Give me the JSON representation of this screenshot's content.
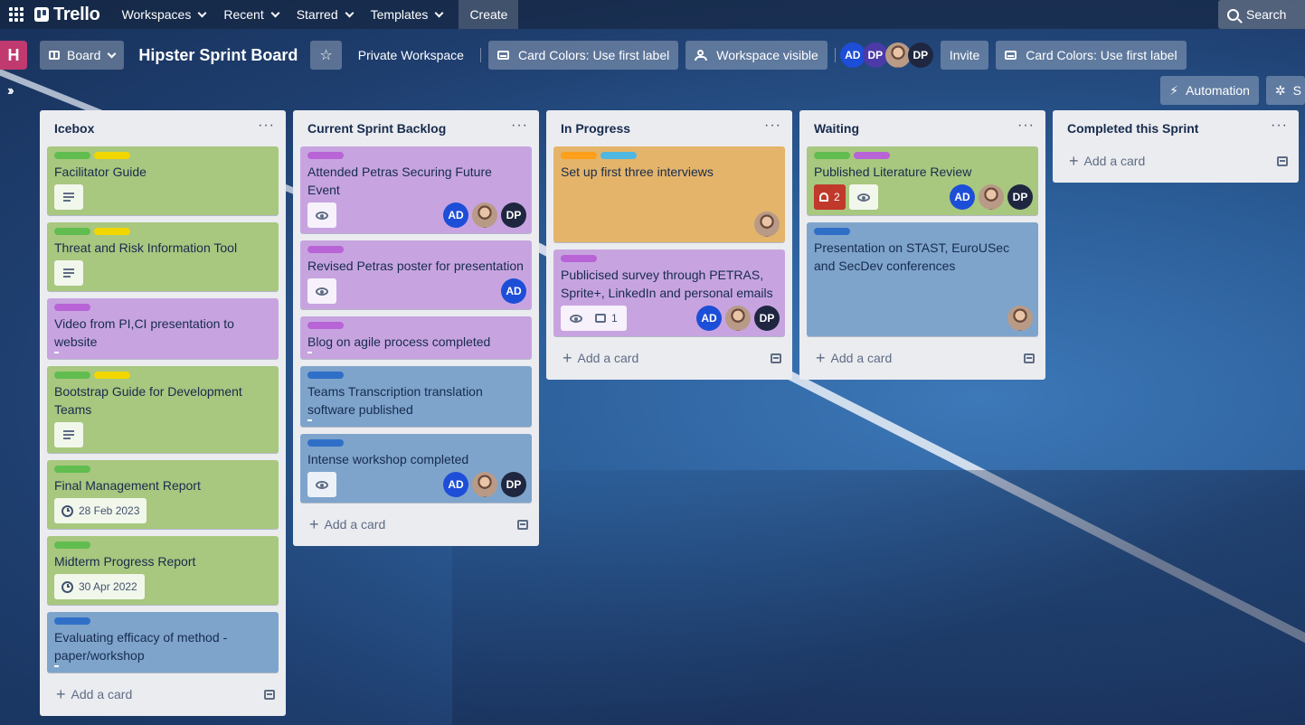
{
  "nav": {
    "brand": "Trello",
    "items": [
      "Workspaces",
      "Recent",
      "Starred",
      "Templates"
    ],
    "create": "Create",
    "search": "Search"
  },
  "header": {
    "workspace_initial": "H",
    "view": "Board",
    "title": "Hipster Sprint Board",
    "workspace": "Private Workspace",
    "card_colors": "Card Colors: Use first label",
    "visibility": "Workspace visible",
    "members": [
      "AD",
      "DP",
      "",
      "DP"
    ],
    "invite": "Invite",
    "card_colors_2": "Card Colors: Use first label",
    "automation": "Automation",
    "extra": "S"
  },
  "colors": {
    "green": "#61bd4f",
    "yellow": "#f2d600",
    "purple": "#b863d6",
    "blue": "#2f6fc7",
    "orange": "#ff9f1a",
    "sky": "#50b7e0"
  },
  "lists": [
    {
      "title": "Icebox",
      "add": "Add a card",
      "cards": [
        {
          "title": "Facilitator Guide",
          "color": "green",
          "labels": [
            "green",
            "yellow"
          ],
          "badges": [
            "description"
          ]
        },
        {
          "title": "Threat and Risk Information Tool",
          "color": "green",
          "labels": [
            "green",
            "yellow"
          ],
          "badges": [
            "description"
          ]
        },
        {
          "title": "Video from PI,CI presentation to website",
          "color": "purple",
          "labels": [
            "purple"
          ],
          "badges": []
        },
        {
          "title": "Bootstrap Guide for Development Teams",
          "color": "green",
          "labels": [
            "green",
            "yellow"
          ],
          "badges": [
            "description"
          ]
        },
        {
          "title": "Final Management Report",
          "color": "green",
          "labels": [
            "green"
          ],
          "due": "28 Feb 2023"
        },
        {
          "title": "Midterm Progress Report",
          "color": "green",
          "labels": [
            "green"
          ],
          "due": "30 Apr 2022"
        },
        {
          "title": "Evaluating efficacy of method - paper/workshop",
          "color": "blue",
          "labels": [
            "blue"
          ],
          "badges": []
        }
      ]
    },
    {
      "title": "Current Sprint Backlog",
      "add": "Add a card",
      "cards": [
        {
          "title": "Attended Petras Securing Future Event",
          "color": "purple",
          "labels": [
            "purple"
          ],
          "badges": [
            "watch"
          ],
          "members": [
            "AD",
            "photo",
            "DP"
          ]
        },
        {
          "title": "Revised Petras poster for presentation",
          "color": "purple",
          "labels": [
            "purple"
          ],
          "badges": [
            "watch"
          ],
          "members": [
            "AD"
          ]
        },
        {
          "title": "Blog on agile process completed",
          "color": "purple",
          "labels": [
            "purple"
          ],
          "badges": []
        },
        {
          "title": "Teams Transcription translation software published",
          "color": "blue",
          "labels": [
            "blue"
          ],
          "badges": []
        },
        {
          "title": "Intense workshop completed",
          "color": "blue",
          "labels": [
            "blue"
          ],
          "badges": [
            "watch"
          ],
          "members": [
            "AD",
            "photo",
            "DP"
          ]
        }
      ]
    },
    {
      "title": "In Progress",
      "add": "Add a card",
      "cards": [
        {
          "title": "Set up first three interviews",
          "color": "orange",
          "labels": [
            "orange",
            "sky"
          ],
          "members": [
            "photo"
          ]
        },
        {
          "title": "Publicised survey through PETRAS, Sprite+, LinkedIn and personal emails",
          "color": "purple",
          "labels": [
            "purple"
          ],
          "badges": [
            "watch",
            "comments"
          ],
          "comments": "1",
          "members": [
            "AD",
            "photo",
            "DP"
          ]
        }
      ]
    },
    {
      "title": "Waiting",
      "add": "Add a card",
      "cards": [
        {
          "title": "Published Literature Review",
          "color": "green",
          "labels": [
            "green",
            "purple"
          ],
          "alert": "2",
          "badges": [
            "watch"
          ],
          "members": [
            "AD",
            "photo",
            "DP"
          ]
        },
        {
          "title": "Presentation on STAST, EuroUSec and SecDev conferences",
          "color": "blue",
          "labels": [
            "blue"
          ],
          "members": [
            "photo"
          ]
        }
      ]
    },
    {
      "title": "Completed this Sprint",
      "add": "Add a card",
      "cards": []
    }
  ]
}
